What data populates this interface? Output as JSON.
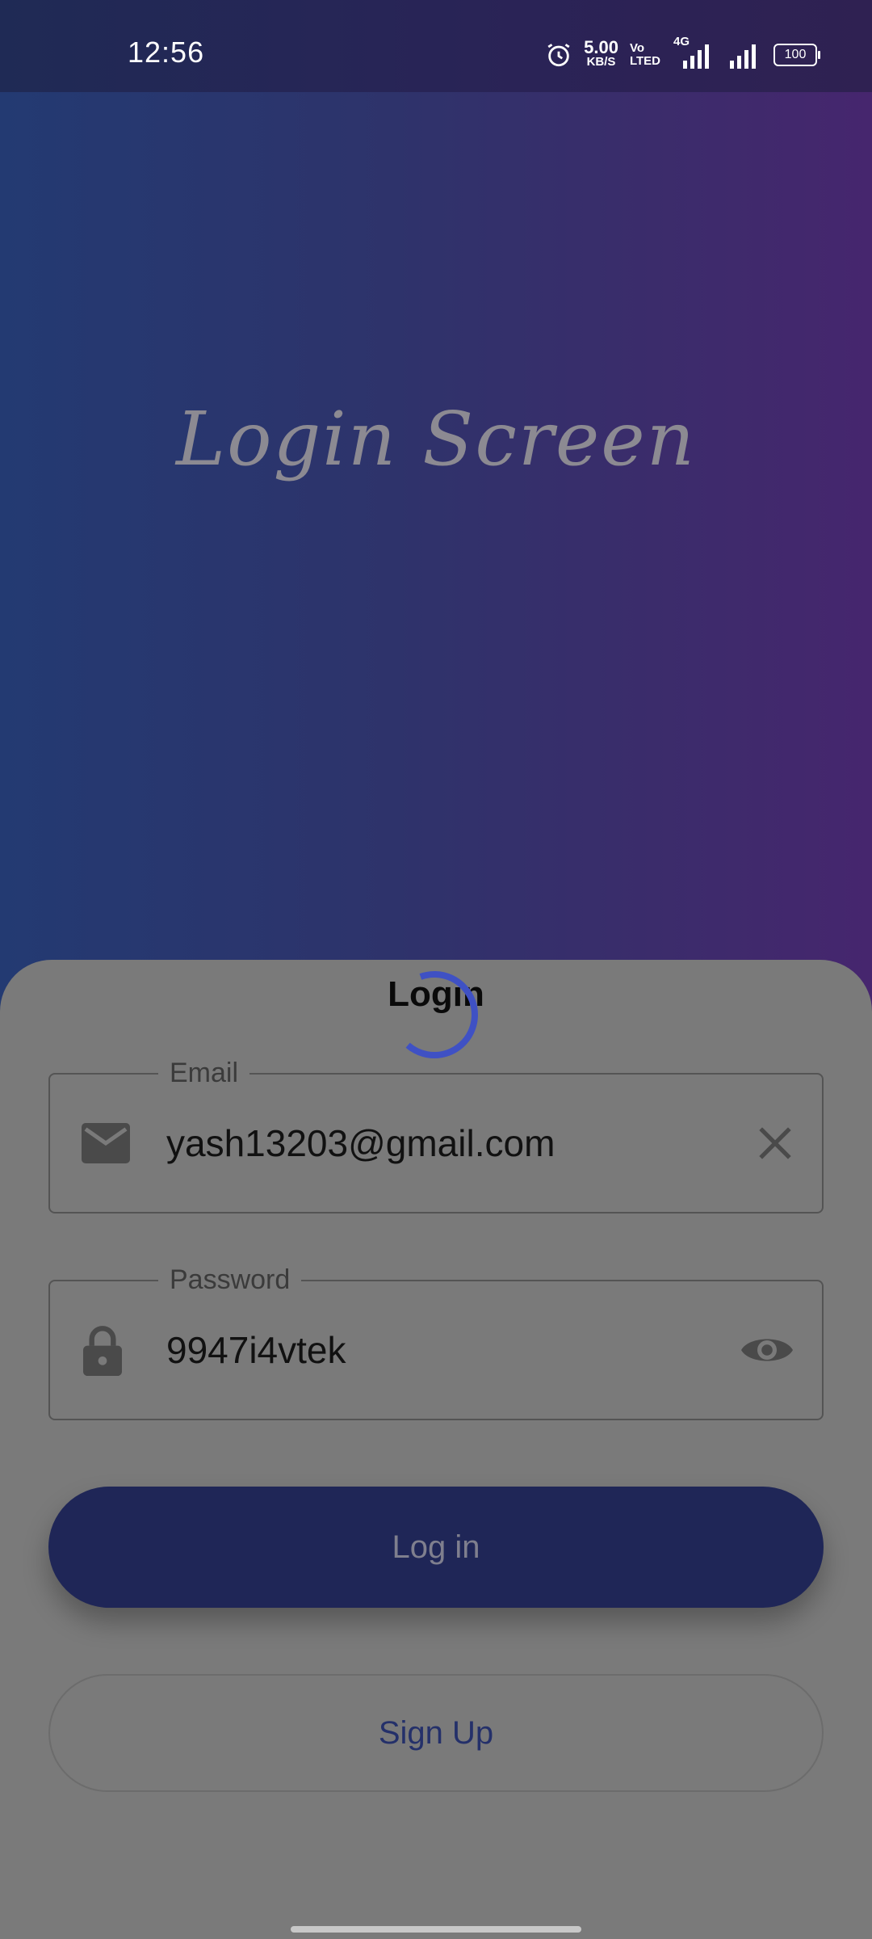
{
  "status_bar": {
    "time": "12:56",
    "net_speed_value": "5.00",
    "net_speed_unit": "KB/S",
    "volte_top": "Vo",
    "volte_bottom": "LTED",
    "network_type": "4G",
    "battery": "100"
  },
  "header": {
    "title": "Login Screen"
  },
  "sheet": {
    "heading": "Login",
    "email": {
      "label": "Email",
      "value": "yash13203@gmail.com",
      "icon": "mail-icon",
      "trailing_icon": "clear-icon"
    },
    "password": {
      "label": "Password",
      "value": "9947i4vtek",
      "icon": "lock-icon",
      "trailing_icon": "eye-icon"
    },
    "login_button": "Log in",
    "signup_button": "Sign Up"
  },
  "colors": {
    "primary": "#1f2657",
    "spinner": "#3f51c4",
    "sheet_overlay": "#7a7a7a"
  }
}
